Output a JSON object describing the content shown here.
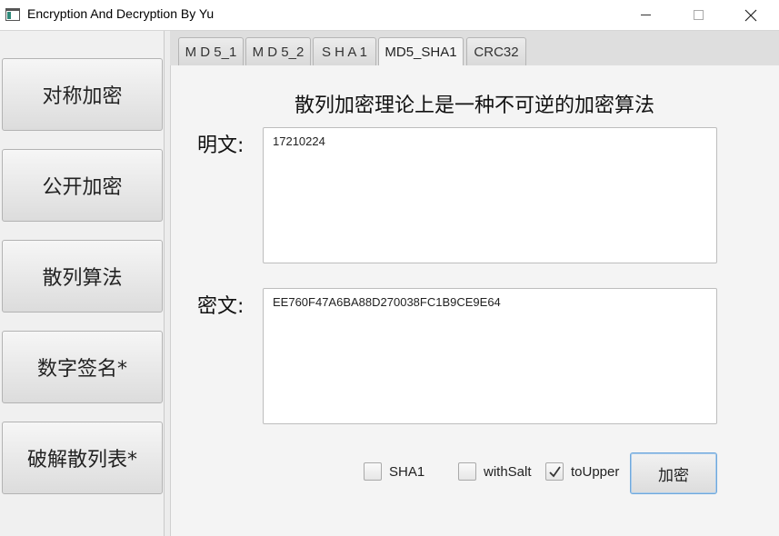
{
  "window": {
    "title": "Encryption And Decryption By Yu"
  },
  "sidebar": {
    "items": [
      {
        "label": "对称加密"
      },
      {
        "label": "公开加密"
      },
      {
        "label": "散列算法"
      },
      {
        "label": "数字签名*"
      },
      {
        "label": "破解散列表*"
      }
    ]
  },
  "tabs": [
    {
      "label": "M D 5_1",
      "active": false
    },
    {
      "label": "M D 5_2",
      "active": false
    },
    {
      "label": "S H A 1",
      "active": false
    },
    {
      "label": "MD5_SHA1",
      "active": true
    },
    {
      "label": "CRC32",
      "active": false
    }
  ],
  "main": {
    "heading": "散列加密理论上是一种不可逆的加密算法",
    "plaintext_label": "明文:",
    "plaintext_value": "17210224",
    "ciphertext_label": "密文:",
    "ciphertext_value": "EE760F47A6BA88D270038FC1B9CE9E64",
    "options": [
      {
        "label": "SHA1",
        "checked": false
      },
      {
        "label": "withSalt",
        "checked": false
      },
      {
        "label": "toUpper",
        "checked": true
      }
    ],
    "action_label": "加密"
  }
}
